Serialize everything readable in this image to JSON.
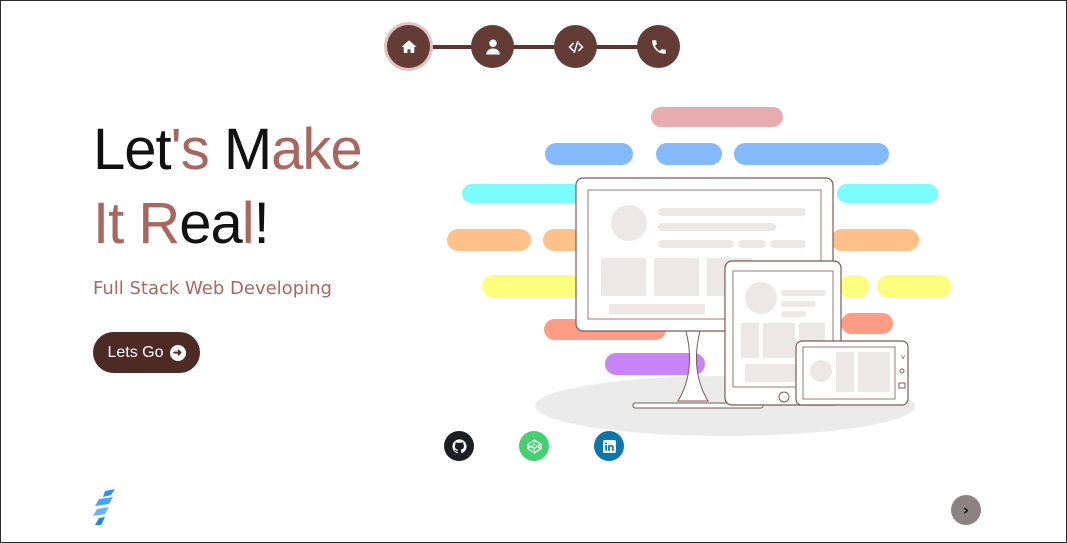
{
  "nav": {
    "items": [
      {
        "icon": "home-icon",
        "active": true
      },
      {
        "icon": "user-icon",
        "active": false
      },
      {
        "icon": "code-icon",
        "active": false
      },
      {
        "icon": "phone-icon",
        "active": false
      }
    ]
  },
  "hero": {
    "title_parts": {
      "p1": "Let",
      "p2": "'s",
      "p3": " M",
      "p4": "ake",
      "p5": "It R",
      "p6": "ea",
      "p7": "l",
      "p8": "!"
    },
    "subtitle": "Full Stack Web Developing",
    "cta_label": "Lets Go"
  },
  "social": {
    "items": [
      {
        "name": "github",
        "color": "#1b1f23"
      },
      {
        "name": "codepen",
        "color": "#47cf73"
      },
      {
        "name": "linkedin",
        "color": "#0e76a8"
      }
    ]
  },
  "colors": {
    "accent": "#a8675f",
    "nav_bg": "#643c36",
    "cta_bg": "#4e2a25"
  }
}
